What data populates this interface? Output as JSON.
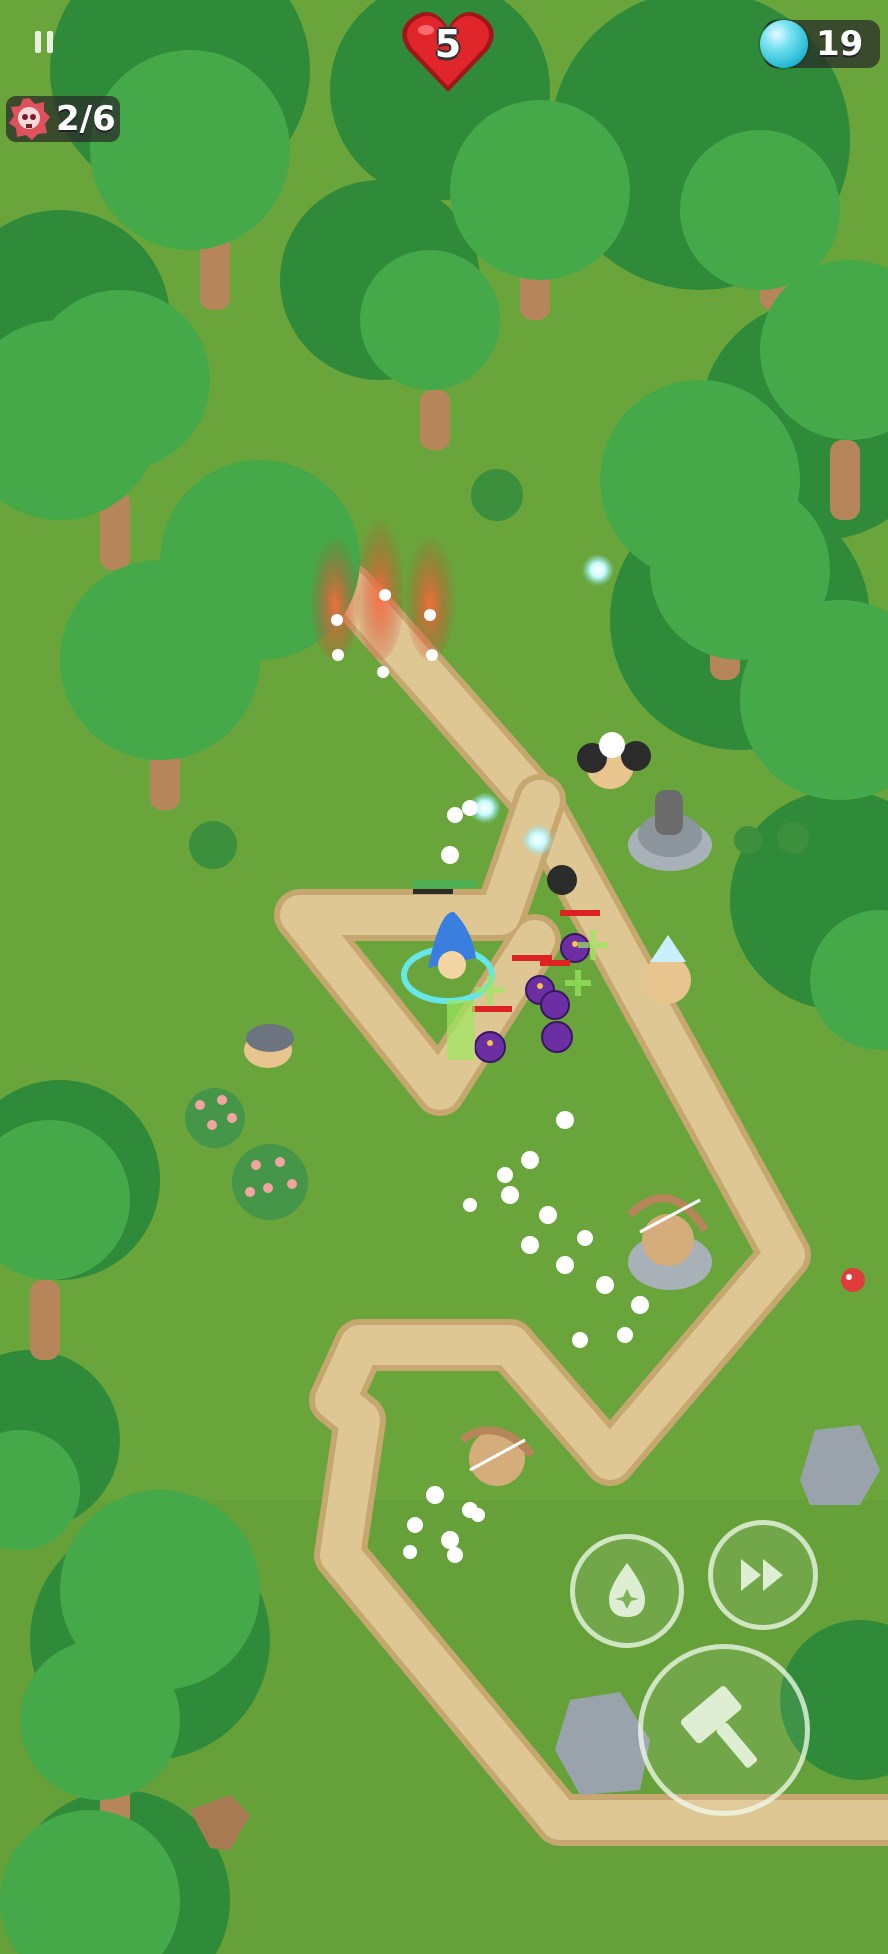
{
  "hud": {
    "lives": "5",
    "gems": "19",
    "wave": "2/6",
    "icons": {
      "pause": "pause-icon",
      "lives": "heart-icon",
      "gems": "gem-icon",
      "wave": "skull-icon"
    }
  },
  "controls": {
    "ability": "water-drop-icon",
    "fast_forward": "fast-forward-icon",
    "build": "hammer-icon"
  },
  "colors": {
    "grass": "#6aa53c",
    "path": "#d9c08c",
    "tree_dark": "#2f8a3a",
    "tree_light": "#43a547",
    "heart": "#e0252b",
    "gem": "#2fc6dc"
  }
}
